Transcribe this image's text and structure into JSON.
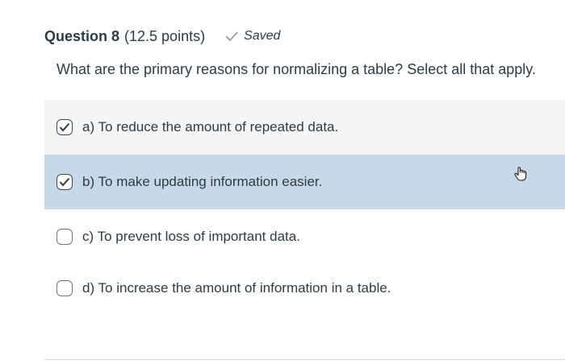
{
  "question": {
    "title": "Question 8",
    "points": "(12.5 points)",
    "saved_label": "Saved",
    "saved_icon": "checkmark-icon",
    "text": "What are the primary reasons for normalizing a table? Select all that apply."
  },
  "answers": [
    {
      "label": "a) To reduce the amount of repeated data.",
      "checked": true
    },
    {
      "label": "b) To make updating information easier.",
      "checked": true
    },
    {
      "label": "c) To prevent loss of important data.",
      "checked": false
    },
    {
      "label": "d) To increase the amount of information in a table.",
      "checked": false
    }
  ],
  "colors": {
    "text": "#2d3b45",
    "hover_row": "#c7d9e8",
    "row_bg": "#f5f5f5"
  }
}
